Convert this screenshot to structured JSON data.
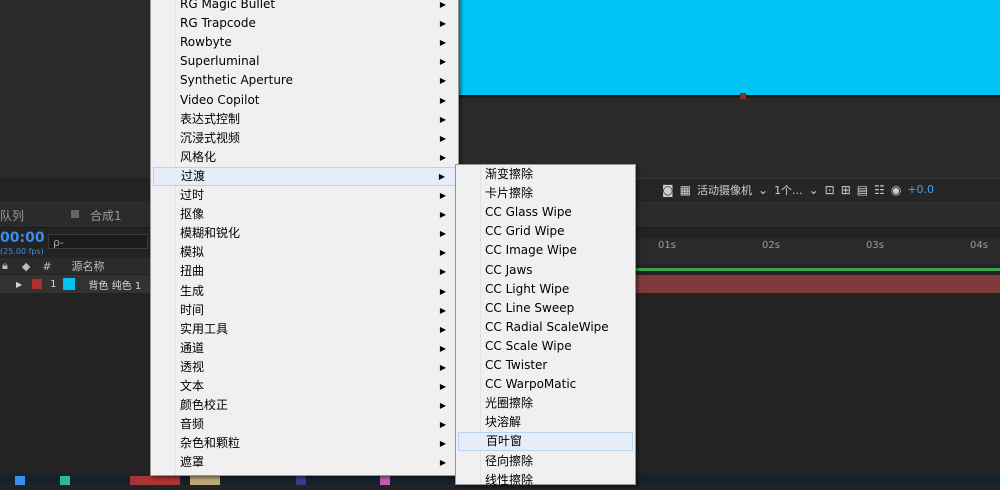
{
  "viewer": {
    "camera_select": "活动摄像机",
    "view_select": "1个...",
    "exposure_value": "+0.0"
  },
  "panels": {
    "render_queue_tab": "队列",
    "comp_tab": "合成1"
  },
  "timeline": {
    "timecode": "00:00",
    "fps": "(25.00 fps)",
    "search_placeholder": "ρ-",
    "col_hash": "#",
    "col_source_name": "源名称",
    "layer_index": "1",
    "layer_name": "背色 纯色 1",
    "ruler_ticks": [
      "01s",
      "02s",
      "03s",
      "04s"
    ]
  },
  "main_menu": {
    "items": [
      {
        "label": "RG Magic Bullet",
        "submenu": true
      },
      {
        "label": "RG Trapcode",
        "submenu": true
      },
      {
        "label": "Rowbyte",
        "submenu": true
      },
      {
        "label": "Superluminal",
        "submenu": true
      },
      {
        "label": "Synthetic Aperture",
        "submenu": true
      },
      {
        "label": "Video Copilot",
        "submenu": true
      },
      {
        "label": "表达式控制",
        "submenu": true
      },
      {
        "label": "沉浸式视频",
        "submenu": true
      },
      {
        "label": "风格化",
        "submenu": true
      },
      {
        "label": "过渡",
        "submenu": true,
        "highlighted": true
      },
      {
        "label": "过时",
        "submenu": true
      },
      {
        "label": "抠像",
        "submenu": true
      },
      {
        "label": "模糊和锐化",
        "submenu": true
      },
      {
        "label": "模拟",
        "submenu": true
      },
      {
        "label": "扭曲",
        "submenu": true
      },
      {
        "label": "生成",
        "submenu": true
      },
      {
        "label": "时间",
        "submenu": true
      },
      {
        "label": "实用工具",
        "submenu": true
      },
      {
        "label": "通道",
        "submenu": true
      },
      {
        "label": "透视",
        "submenu": true
      },
      {
        "label": "文本",
        "submenu": true
      },
      {
        "label": "颜色校正",
        "submenu": true
      },
      {
        "label": "音频",
        "submenu": true
      },
      {
        "label": "杂色和颗粒",
        "submenu": true
      },
      {
        "label": "遮罩",
        "submenu": true
      }
    ]
  },
  "sub_menu": {
    "items": [
      {
        "label": "渐变擦除"
      },
      {
        "label": "卡片擦除"
      },
      {
        "label": "CC Glass Wipe"
      },
      {
        "label": "CC Grid Wipe"
      },
      {
        "label": "CC Image Wipe"
      },
      {
        "label": "CC Jaws"
      },
      {
        "label": "CC Light Wipe"
      },
      {
        "label": "CC Line Sweep"
      },
      {
        "label": "CC Radial ScaleWipe"
      },
      {
        "label": "CC Scale Wipe"
      },
      {
        "label": "CC Twister"
      },
      {
        "label": "CC WarpoMatic"
      },
      {
        "label": "光圈擦除"
      },
      {
        "label": "块溶解"
      },
      {
        "label": "百叶窗",
        "highlighted": true
      },
      {
        "label": "径向擦除"
      },
      {
        "label": "线性擦除"
      }
    ]
  },
  "colors": {
    "comp_background": "#00c4f4",
    "menu_background": "#f0f0f0",
    "menu_highlight": "#e5eef8",
    "timecode_blue": "#3a8ee6",
    "layer_bar": "#7e3a3a"
  }
}
